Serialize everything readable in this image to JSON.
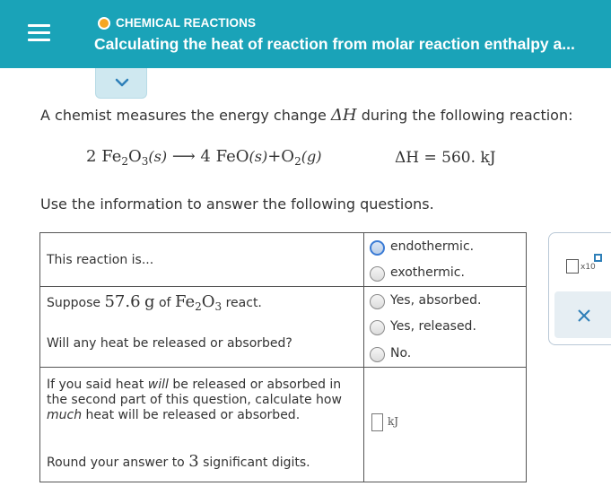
{
  "header": {
    "topic": "CHEMICAL REACTIONS",
    "title": "Calculating the heat of reaction from molar reaction enthalpy a...",
    "colors": {
      "background": "#1aa3b8",
      "topic_dot": "#f5a623"
    }
  },
  "icons": {
    "menu": "hamburger-menu-icon",
    "expand": "chevron-down-icon",
    "close": "close-icon"
  },
  "problem": {
    "intro_before": "A chemist measures the energy change",
    "intro_symbol": "ΔH",
    "intro_after": "during the following reaction:",
    "equation": {
      "coef1": "2",
      "reactant": "Fe",
      "reactant_sub1": "2",
      "reactant_O": "O",
      "reactant_sub2": "3",
      "reactant_state": "(s)",
      "arrow": "⟶",
      "coef2": "4",
      "product1": "FeO",
      "product1_state": "(s)",
      "plus": "+",
      "product2": "O",
      "product2_sub": "2",
      "product2_state": "(g)"
    },
    "delta_h": "ΔH = 560. kJ",
    "use_info": "Use the information to answer the following questions."
  },
  "questions": {
    "q1": {
      "text": "This reaction is...",
      "options": [
        "endothermic.",
        "exothermic."
      ]
    },
    "q2": {
      "prefix": "Suppose",
      "mass": "57.6",
      "unit_g": "g",
      "of": "of",
      "compound_fe": "Fe",
      "sub1": "2",
      "compound_o": "O",
      "sub2": "3",
      "suffix": "react.",
      "question": "Will any heat be released or absorbed?",
      "options": [
        "Yes, absorbed.",
        "Yes, released.",
        "No."
      ]
    },
    "q3": {
      "line1_a": "If you said heat",
      "line1_will": "will",
      "line1_b": "be released or absorbed in",
      "line2": "the second part of this question, calculate how",
      "line3_much": "much",
      "line3_b": "heat will be released or absorbed.",
      "round_a": "Round your answer to",
      "round_digits": "3",
      "round_b": "significant digits.",
      "answer_value": "",
      "answer_unit": "kJ"
    }
  },
  "side_panel": {
    "x10_label": "x10"
  }
}
